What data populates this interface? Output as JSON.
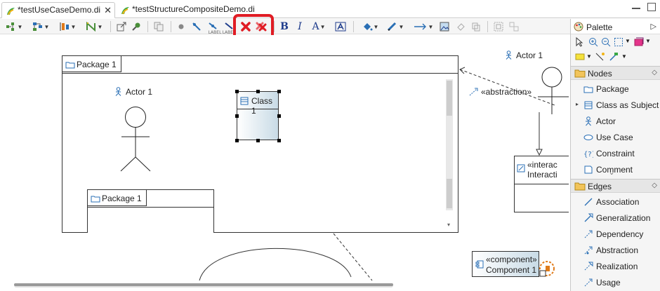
{
  "tabs": [
    {
      "label": "*testUseCaseDemo.di",
      "close": "✕",
      "active": true
    },
    {
      "label": "*testStructureCompositeDemo.di",
      "active": false
    }
  ],
  "toolbar": {
    "text_bold": "B",
    "text_italic": "I",
    "text_font": "A",
    "label_a": "LABEL",
    "label_b": "LABEL"
  },
  "canvas": {
    "package_outer": {
      "name": "Package 1"
    },
    "package_inner": {
      "name": "Package 1"
    },
    "actor_inside": {
      "name": "Actor 1"
    },
    "actor_outside": {
      "name": "Actor 1"
    },
    "class": {
      "name": "Class 1"
    },
    "abstraction_label": "«abstraction»",
    "interaction": {
      "stereotype": "«interac",
      "name": "Interacti"
    },
    "component": {
      "stereotype": "«component»",
      "name": "Component 1"
    }
  },
  "palette": {
    "title": "Palette",
    "drawers": [
      {
        "label": "Nodes",
        "items": [
          {
            "label": "Package",
            "icon": "package-icon"
          },
          {
            "label": "Class as Subject",
            "icon": "class-icon"
          },
          {
            "label": "Actor",
            "icon": "actor-icon"
          },
          {
            "label": "Use Case",
            "icon": "use-case-icon"
          },
          {
            "label": "Constraint",
            "icon": "constraint-icon"
          },
          {
            "label": "Comment",
            "icon": "comment-icon"
          }
        ]
      },
      {
        "label": "Edges",
        "items": [
          {
            "label": "Association",
            "icon": "association-icon"
          },
          {
            "label": "Generalization",
            "icon": "generalization-icon"
          },
          {
            "label": "Dependency",
            "icon": "dependency-icon"
          },
          {
            "label": "Abstraction",
            "icon": "abstraction-icon"
          },
          {
            "label": "Realization",
            "icon": "realization-icon"
          },
          {
            "label": "Usage",
            "icon": "usage-icon"
          }
        ]
      }
    ]
  },
  "colors": {
    "highlight": "#e01c24",
    "accent_blue": "#1e3c8c",
    "class_fill": "#c9dbe6"
  }
}
